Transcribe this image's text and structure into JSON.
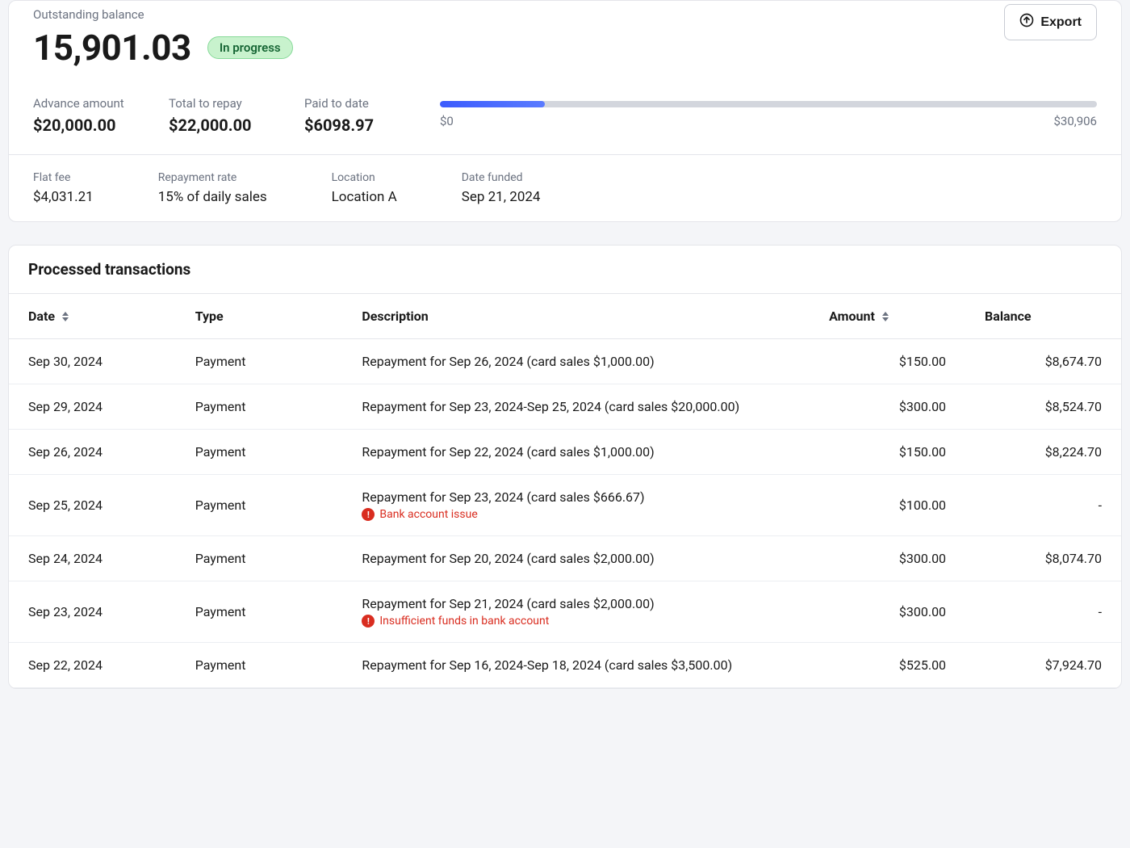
{
  "summary": {
    "outstanding_label": "Outstanding balance",
    "outstanding_value": "15,901.03",
    "status_badge": "In progress",
    "export_label": "Export",
    "metrics": {
      "advance_label": "Advance amount",
      "advance_value": "$20,000.00",
      "total_label": "Total to repay",
      "total_value": "$22,000.00",
      "paid_label": "Paid to date",
      "paid_value": "$6098.97"
    },
    "progress": {
      "min_label": "$0",
      "max_label": "$30,906",
      "percent": 16
    },
    "details": {
      "flat_fee_label": "Flat fee",
      "flat_fee_value": "$4,031.21",
      "repay_rate_label": "Repayment rate",
      "repay_rate_value": "15% of daily sales",
      "location_label": "Location",
      "location_value": "Location A",
      "date_funded_label": "Date funded",
      "date_funded_value": "Sep 21, 2024"
    }
  },
  "transactions": {
    "title": "Processed transactions",
    "columns": {
      "date": "Date",
      "type": "Type",
      "description": "Description",
      "amount": "Amount",
      "balance": "Balance"
    },
    "rows": [
      {
        "date": "Sep 30, 2024",
        "type": "Payment",
        "description": "Repayment for Sep 26, 2024 (card sales $1,000.00)",
        "amount": "$150.00",
        "balance": "$8,674.70"
      },
      {
        "date": "Sep 29, 2024",
        "type": "Payment",
        "description": "Repayment for Sep 23, 2024-Sep 25, 2024 (card sales $20,000.00)",
        "amount": "$300.00",
        "balance": "$8,524.70"
      },
      {
        "date": "Sep 26, 2024",
        "type": "Payment",
        "description": "Repayment for Sep 22, 2024 (card sales $1,000.00)",
        "amount": "$150.00",
        "balance": "$8,224.70"
      },
      {
        "date": "Sep 25, 2024",
        "type": "Payment",
        "description": "Repayment for Sep 23, 2024 (card sales $666.67)",
        "error": "Bank account issue",
        "amount": "$100.00",
        "balance": "-"
      },
      {
        "date": "Sep 24, 2024",
        "type": "Payment",
        "description": "Repayment for Sep 20, 2024 (card sales $2,000.00)",
        "amount": "$300.00",
        "balance": "$8,074.70"
      },
      {
        "date": "Sep 23, 2024",
        "type": "Payment",
        "description": "Repayment for Sep 21, 2024 (card sales $2,000.00)",
        "error": "Insufficient funds in bank account",
        "amount": "$300.00",
        "balance": "-"
      },
      {
        "date": "Sep 22, 2024",
        "type": "Payment",
        "description": "Repayment for Sep 16, 2024-Sep 18, 2024 (card sales $3,500.00)",
        "amount": "$525.00",
        "balance": "$7,924.70"
      }
    ]
  }
}
